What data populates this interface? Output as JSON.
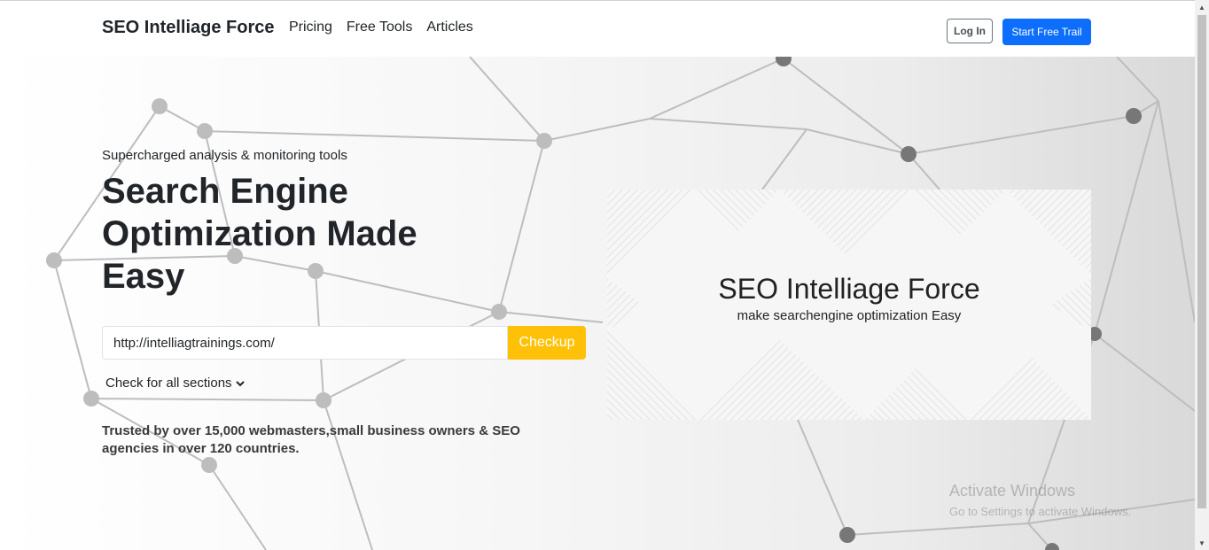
{
  "nav": {
    "brand": "SEO Intelliage Force",
    "links": [
      "Pricing",
      "Free Tools",
      "Articles"
    ],
    "login_label": "Log In",
    "trial_label": "Start Free Trail"
  },
  "hero": {
    "tagline": "Supercharged analysis & monitoring tools",
    "headline": "Search Engine Optimization Made Easy",
    "search": {
      "value": "http://intelliagtrainings.com/",
      "button_label": "Checkup"
    },
    "sections_select": "Check for all sections",
    "trusted": "Trusted by over 15,000 webmasters,small business owners & SEO agencies in over 120 countries."
  },
  "banner": {
    "title": "SEO Intelliage Force",
    "subtitle": "make searchengine optimization Easy"
  },
  "watermark": {
    "line1": "Activate Windows",
    "line2": "Go to Settings to activate Windows."
  },
  "colors": {
    "primary": "#0d6efd",
    "warning": "#ffc107",
    "text": "#212529"
  },
  "icons": {
    "select_chevron": "chevron-down-icon",
    "scroll_up": "scroll-up-arrow-icon",
    "scroll_down": "scroll-down-arrow-icon"
  }
}
